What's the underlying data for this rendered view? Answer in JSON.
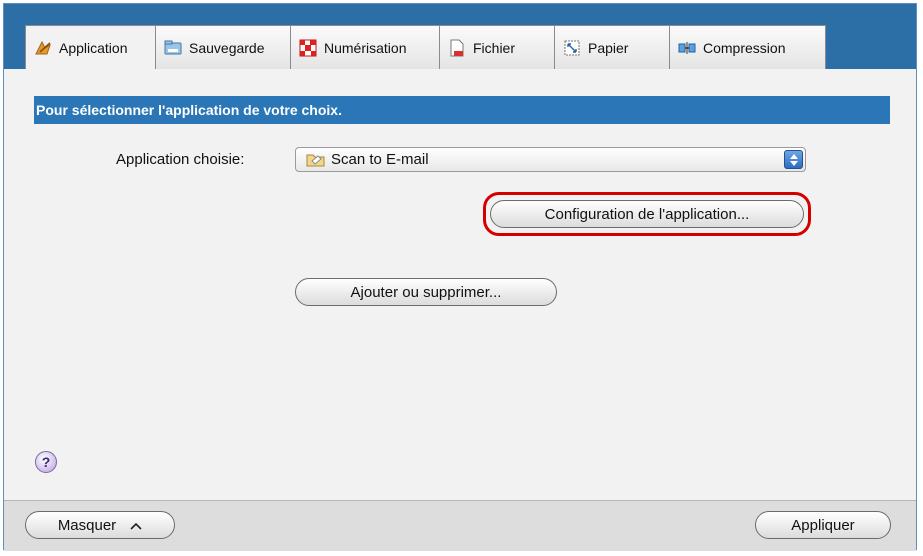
{
  "tabs": [
    {
      "label": "Application",
      "icon": "application-icon",
      "active": true
    },
    {
      "label": "Sauvegarde",
      "icon": "folder-icon",
      "active": false
    },
    {
      "label": "Numérisation",
      "icon": "scan-icon",
      "active": false
    },
    {
      "label": "Fichier",
      "icon": "file-icon",
      "active": false
    },
    {
      "label": "Papier",
      "icon": "paper-icon",
      "active": false
    },
    {
      "label": "Compression",
      "icon": "compression-icon",
      "active": false
    }
  ],
  "content": {
    "banner": "Pour sélectionner l'application de votre choix.",
    "app_label": "Application choisie:",
    "app_selected": "Scan to E-mail",
    "config_button": "Configuration de l'application...",
    "add_remove_button": "Ajouter ou supprimer...",
    "help_label": "?"
  },
  "footer": {
    "hide_button": "Masquer",
    "apply_button": "Appliquer"
  },
  "colors": {
    "tabbar": "#2c6fa7",
    "banner": "#2a76b6",
    "highlight": "#d40000"
  }
}
